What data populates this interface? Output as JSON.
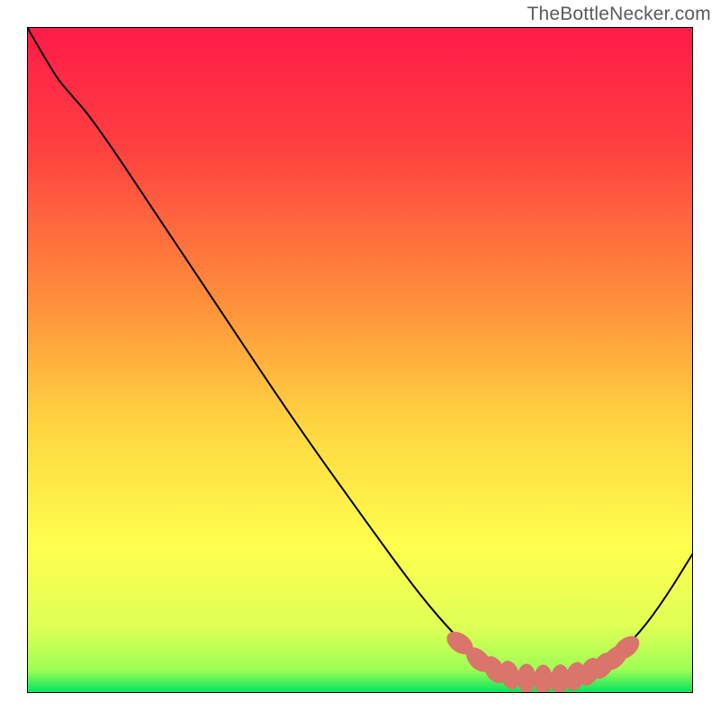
{
  "watermark": "TheBottleNecker.com",
  "chart_data": {
    "type": "line",
    "title": "",
    "xlabel": "",
    "ylabel": "",
    "xlim": [
      0,
      100
    ],
    "ylim": [
      0,
      100
    ],
    "gradient_stops": [
      {
        "offset": 0.0,
        "color": "#ff1a49"
      },
      {
        "offset": 0.18,
        "color": "#ff4040"
      },
      {
        "offset": 0.4,
        "color": "#ff8b3b"
      },
      {
        "offset": 0.6,
        "color": "#ffd640"
      },
      {
        "offset": 0.78,
        "color": "#ffff4e"
      },
      {
        "offset": 0.9,
        "color": "#dfff55"
      },
      {
        "offset": 0.965,
        "color": "#9fff55"
      },
      {
        "offset": 1.0,
        "color": "#00e35e"
      }
    ],
    "series": [
      {
        "name": "curve",
        "stroke": "#000000",
        "stroke_width": 2,
        "points": [
          {
            "x": 0.0,
            "y": 100.0
          },
          {
            "x": 4.0,
            "y": 93.0
          },
          {
            "x": 6.0,
            "y": 90.5
          },
          {
            "x": 10.0,
            "y": 86.0
          },
          {
            "x": 20.0,
            "y": 71.0
          },
          {
            "x": 30.0,
            "y": 56.0
          },
          {
            "x": 40.0,
            "y": 41.0
          },
          {
            "x": 50.0,
            "y": 27.0
          },
          {
            "x": 58.0,
            "y": 16.0
          },
          {
            "x": 63.0,
            "y": 10.0
          },
          {
            "x": 67.0,
            "y": 6.0
          },
          {
            "x": 70.0,
            "y": 3.8
          },
          {
            "x": 73.0,
            "y": 2.5
          },
          {
            "x": 77.0,
            "y": 2.0
          },
          {
            "x": 81.0,
            "y": 2.2
          },
          {
            "x": 85.0,
            "y": 3.4
          },
          {
            "x": 88.0,
            "y": 5.2
          },
          {
            "x": 92.0,
            "y": 9.0
          },
          {
            "x": 96.0,
            "y": 14.5
          },
          {
            "x": 100.0,
            "y": 21.0
          }
        ]
      }
    ],
    "markers": {
      "color": "#d9756a",
      "rx": 1.4,
      "ry": 2.2,
      "points": [
        {
          "x": 65.0,
          "y": 7.5,
          "rot": -55
        },
        {
          "x": 67.8,
          "y": 5.0,
          "rot": -45
        },
        {
          "x": 70.2,
          "y": 3.5,
          "rot": -30
        },
        {
          "x": 72.5,
          "y": 2.7,
          "rot": -15
        },
        {
          "x": 75.0,
          "y": 2.2,
          "rot": 0
        },
        {
          "x": 77.5,
          "y": 2.05,
          "rot": 0
        },
        {
          "x": 80.0,
          "y": 2.1,
          "rot": 5
        },
        {
          "x": 82.3,
          "y": 2.5,
          "rot": 15
        },
        {
          "x": 84.5,
          "y": 3.2,
          "rot": 25
        },
        {
          "x": 86.5,
          "y": 4.1,
          "rot": 35
        },
        {
          "x": 88.3,
          "y": 5.3,
          "rot": 45
        },
        {
          "x": 90.0,
          "y": 6.8,
          "rot": 52
        }
      ]
    }
  }
}
